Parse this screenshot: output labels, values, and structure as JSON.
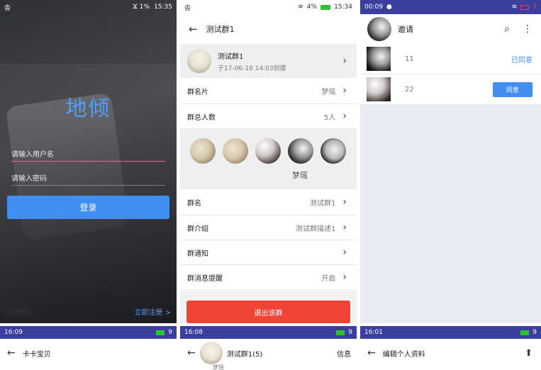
{
  "login": {
    "status_left": "沓 ",
    "status_right": "Ϫ 1%",
    "status_time": "15:35",
    "logo": "地倾",
    "username_placeholder": "请输入用户名",
    "password_placeholder": "请输入密码",
    "login_button": "登录",
    "register_link": "立即注册 >",
    "bottom_left": "忘记密码"
  },
  "group_settings": {
    "status_left": "沓",
    "status_right": "4%",
    "status_time": "15:34",
    "title": "测试群1",
    "group_name": "测试群1",
    "group_created": "于17-06-10 14:03创建",
    "rows": [
      {
        "label": "群名片",
        "value": "梦瑶"
      },
      {
        "label": "群总人数",
        "value": "5人"
      }
    ],
    "member_name": "梦瑶",
    "rows2": [
      {
        "label": "群名",
        "value": "测试群1"
      },
      {
        "label": "群介绍",
        "value": "测试群描述1"
      },
      {
        "label": "群通知",
        "value": ""
      },
      {
        "label": "群消息提醒",
        "value": "开启"
      }
    ],
    "exit_button": "退出该群"
  },
  "invite": {
    "status_time": "00:09",
    "status_right": "7",
    "title": "邀请",
    "items": [
      {
        "name": "11",
        "action": "已同意"
      },
      {
        "name": "22",
        "action": "同意"
      }
    ]
  },
  "bottom_left": {
    "status_time": "16:09",
    "status_right": "9",
    "title": "卡卡宝贝"
  },
  "bottom_mid": {
    "status_time": "16:08",
    "status_right": "9",
    "title": "测试群1(5)",
    "action": "信息",
    "sub": "梦瑶"
  },
  "bottom_right": {
    "status_time": "16:01",
    "status_right": "9",
    "title": "编辑个人资料"
  },
  "colors": {
    "accent": "#3f8ef0",
    "danger": "#f24436",
    "indigo": "#3644a3",
    "statusbar_dark": "#3a3f9e",
    "green_battery": "#2fc330"
  }
}
